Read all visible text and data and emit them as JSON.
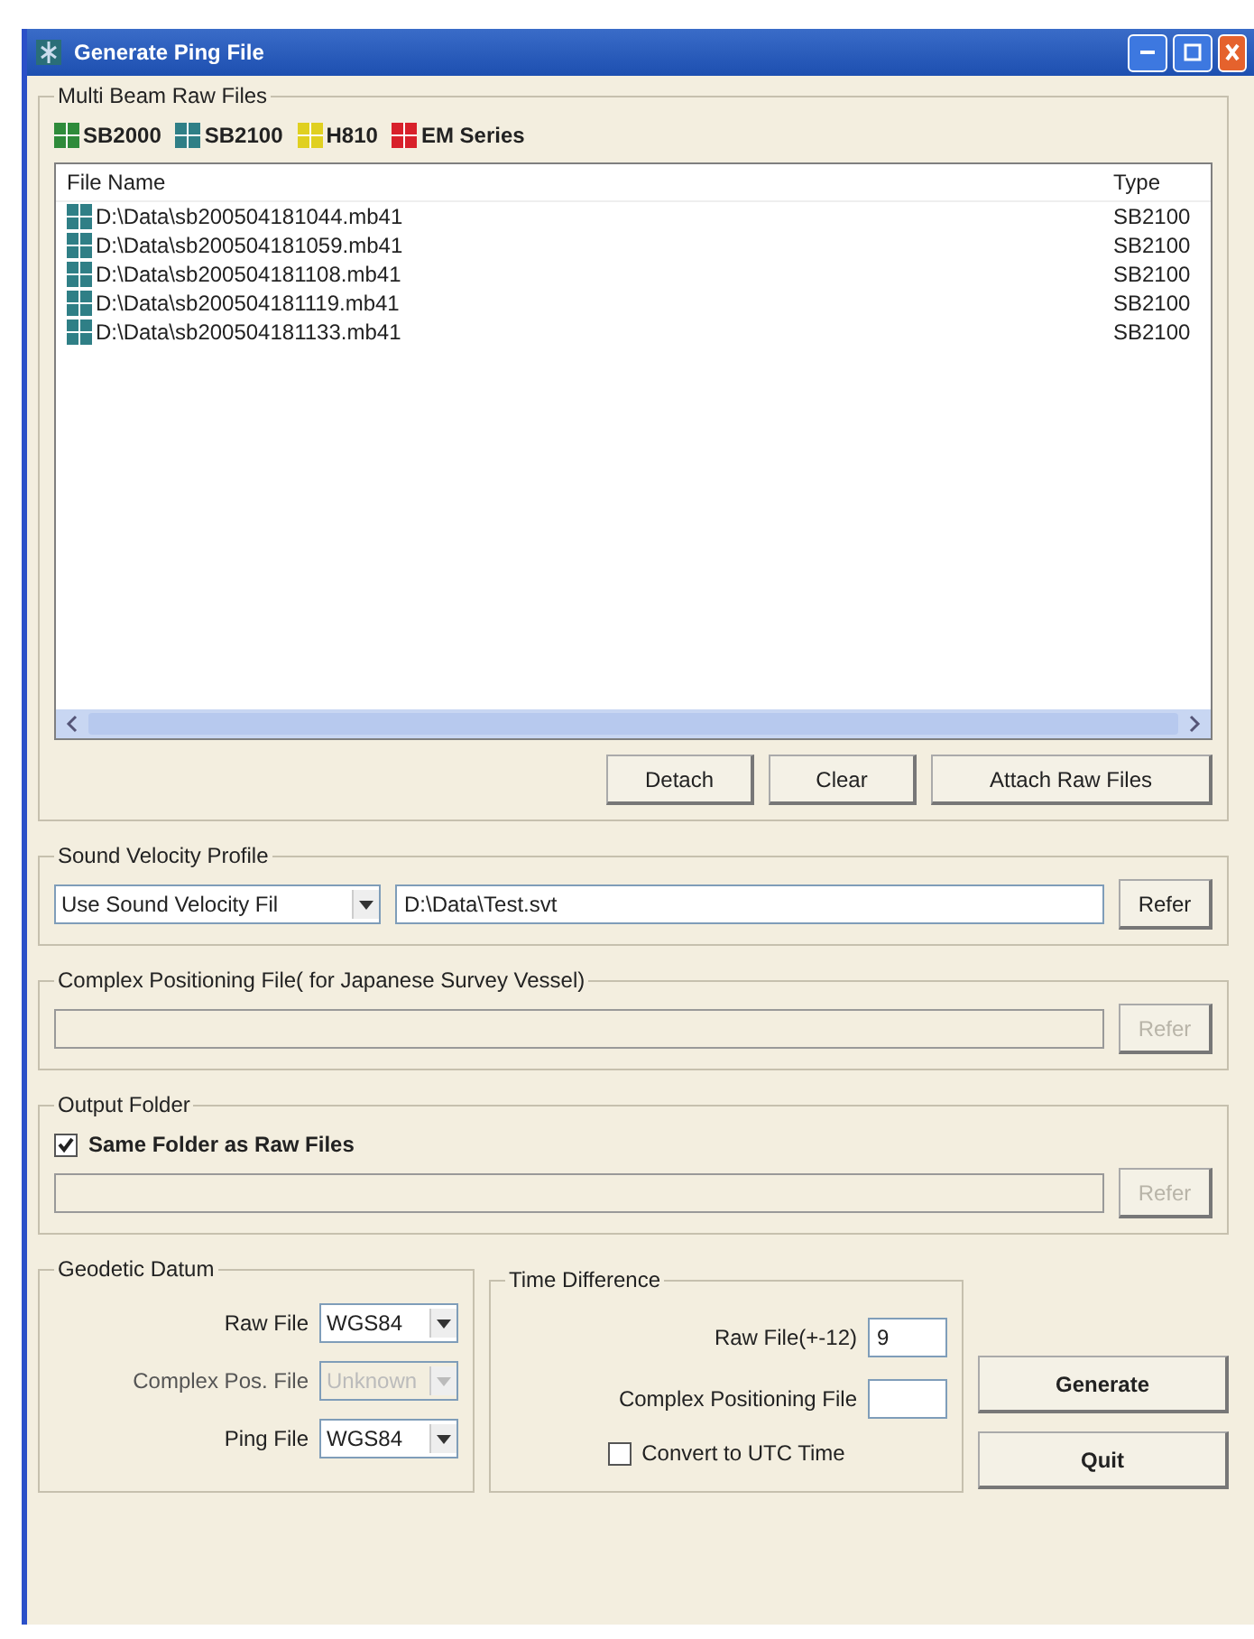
{
  "window": {
    "title": "Generate Ping File"
  },
  "raw_files": {
    "title": "Multi Beam Raw Files",
    "legend": [
      {
        "label": "SB2000",
        "color": "#2e8b3a"
      },
      {
        "label": "SB2100",
        "color": "#2f7f86"
      },
      {
        "label": "H810",
        "color": "#e0d020"
      },
      {
        "label": "EM Series",
        "color": "#d8202a"
      }
    ],
    "columns": [
      "File Name",
      "Type"
    ],
    "rows": [
      {
        "name": "D:\\Data\\sb200504181044.mb41",
        "type": "SB2100",
        "color": "#2f7f86"
      },
      {
        "name": "D:\\Data\\sb200504181059.mb41",
        "type": "SB2100",
        "color": "#2f7f86"
      },
      {
        "name": "D:\\Data\\sb200504181108.mb41",
        "type": "SB2100",
        "color": "#2f7f86"
      },
      {
        "name": "D:\\Data\\sb200504181119.mb41",
        "type": "SB2100",
        "color": "#2f7f86"
      },
      {
        "name": "D:\\Data\\sb200504181133.mb41",
        "type": "SB2100",
        "color": "#2f7f86"
      }
    ],
    "buttons": [
      "Detach",
      "Clear",
      "Attach Raw Files"
    ]
  },
  "sound_velocity": {
    "title": "Sound Velocity Profile",
    "mode": "Use Sound Velocity Fil",
    "path": "D:\\Data\\Test.svt",
    "button": {
      "label": "Refer",
      "disabled": false
    }
  },
  "complex_positioning": {
    "title": "Complex Positioning File( for Japanese Survey Vessel)",
    "button": {
      "label": "Refer",
      "disabled": true
    }
  },
  "output_folder": {
    "title": "Output Folder",
    "same_folder": {
      "label": "Same Folder as Raw Files",
      "checked": true
    },
    "button": {
      "label": "Refer",
      "disabled": true
    }
  },
  "geodetic_datum": {
    "title": "Geodetic Datum",
    "rows": [
      {
        "label": "Raw File",
        "value": "WGS84",
        "disabled": false
      },
      {
        "label": "Complex Pos. File",
        "value": "Unknown",
        "disabled": true
      },
      {
        "label": "Ping File",
        "value": "WGS84",
        "disabled": false
      }
    ]
  },
  "time_difference": {
    "title": "Time Difference",
    "raw_label": "Raw File(+-12)",
    "raw_value": "9",
    "complex_label": "Complex Positioning File",
    "utc": {
      "label": "Convert to UTC Time",
      "checked": false
    }
  },
  "actions": [
    "Generate",
    "Quit"
  ]
}
